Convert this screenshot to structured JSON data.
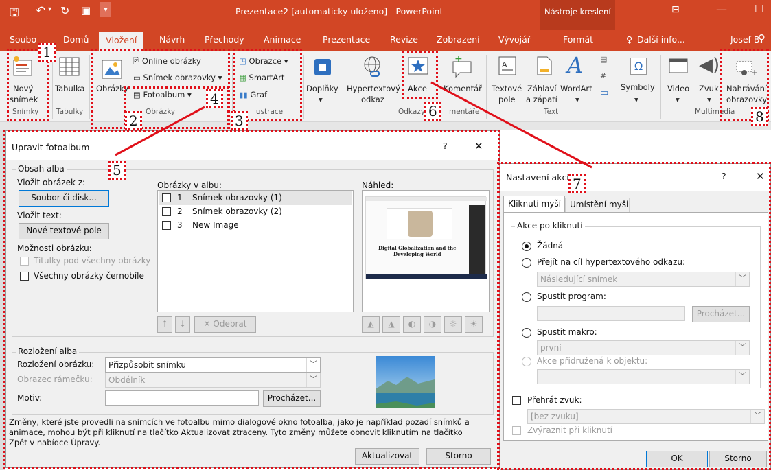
{
  "app": {
    "title": "Prezentace2 [automaticky uloženo] - PowerPoint",
    "context_tools": "Nástroje kreslení",
    "context_tab": "Formát",
    "tell_me": "Další info...",
    "user": "Josef B.",
    "accent": "#d24625"
  },
  "tabs": [
    "Soubor",
    "Domů",
    "Vložení",
    "Návrh",
    "Přechody",
    "Animace",
    "Prezentace",
    "Revize",
    "Zobrazení",
    "Vývojář"
  ],
  "tabs_visible": {
    "soubor": "Soubo",
    "domu": "Domů"
  },
  "ribbon": {
    "novy_snimek": [
      "Nový",
      "snímek"
    ],
    "tabulka": "Tabulka",
    "obrazky": "Obrázky",
    "online_obrazky": "Online obrázky",
    "snimek_obrazovky": "Snímek obrazovky",
    "fotoalbum": "Fotoalbum",
    "obrazce": "Obrazce",
    "smartart": "SmartArt",
    "graf": "Graf",
    "doplnky": "Doplňky",
    "hypertext": [
      "Hypertextový",
      "odkaz"
    ],
    "akce": "Akce",
    "komentar": "Komentář",
    "textove_pole": [
      "Textové",
      "pole"
    ],
    "zahlavi": [
      "Záhlaví",
      "a zápatí"
    ],
    "wordart": "WordArt",
    "symboly": "Symboly",
    "video": "Video",
    "zvuk": "Zvuk",
    "nahravani": [
      "Nahrávání",
      "obrazovky"
    ],
    "groups": {
      "snimky": "Snímky",
      "tabulky": "Tabulky",
      "obrazky": "Obrázky",
      "ilustrace": "lustrace",
      "odkazy": "Odkazy",
      "komentare": "mentáře",
      "text": "Text",
      "multimedia": "Multimédia"
    }
  },
  "fotoalbum_dialog": {
    "title": "Upravit fotoalbum",
    "help": "?",
    "close": "✕",
    "obsah_alba": "Obsah alba",
    "vlozit_obrazek": "Vložit obrázek z:",
    "soubor_btn": "Soubor či disk...",
    "vlozit_text": "Vložit text:",
    "nove_pole_btn": "Nové textové pole",
    "moznosti": "Možnosti obrázku:",
    "titulky": "Titulky pod všechny obrázky",
    "cernobile": "Všechny obrázky černobíle",
    "obrazky_v_albu": "Obrázky v albu:",
    "album_items": [
      {
        "n": "1",
        "label": "Snímek obrazovky (1)"
      },
      {
        "n": "2",
        "label": "Snímek obrazovky (2)"
      },
      {
        "n": "3",
        "label": "New Image"
      }
    ],
    "odebrat": "Odebrat",
    "nahled": "Náhled:",
    "preview_caption": [
      "Digital Globalization and the",
      "Developing World"
    ],
    "rozlozeni_alba": "Rozložení alba",
    "rozlozeni_obrazku": "Rozložení obrázku:",
    "rozlozeni_value": "Přizpůsobit snímku",
    "obrazec_ramecku": "Obrazec rámečku:",
    "obrazec_value": "Obdélník",
    "motiv": "Motiv:",
    "prochazet": "Procházet...",
    "note": [
      "Změny, které jste provedli na snímcích ve fotoalbu mimo dialogové okno fotoalba, jako je například pozadí snímků a",
      "animace, mohou být při kliknutí na tlačítko Aktualizovat ztraceny. Tyto změny můžete obnovit kliknutím na tlačítko",
      "Zpět v nabídce Úpravy."
    ],
    "aktualizovat": "Aktualizovat",
    "storno": "Storno"
  },
  "akce_dialog": {
    "title": "Nastavení akcí",
    "help": "?",
    "close": "✕",
    "tab_click": "Kliknutí myší",
    "tab_hover": "Umístění myši",
    "group": "Akce po kliknutí",
    "zadna": "Žádná",
    "prejit": "Přejít na cíl hypertextového odkazu:",
    "prejit_value": "Následující snímek",
    "spustit_program": "Spustit program:",
    "prochazet": "Procházet...",
    "spustit_makro": "Spustit makro:",
    "makro_value": "první",
    "akce_objekt": "Akce přidružená k objektu:",
    "prehrat_zvuk": "Přehrát zvuk:",
    "zvuk_value": "[bez zvuku]",
    "zvyraznit": "Zvýraznit při kliknutí",
    "ok": "OK",
    "storno": "Storno"
  },
  "callouts": [
    "1",
    "2",
    "3",
    "4",
    "5",
    "6",
    "7",
    "8"
  ],
  "colors": {
    "annotation": "#e0101a",
    "ribbon_red": "#d24625"
  }
}
